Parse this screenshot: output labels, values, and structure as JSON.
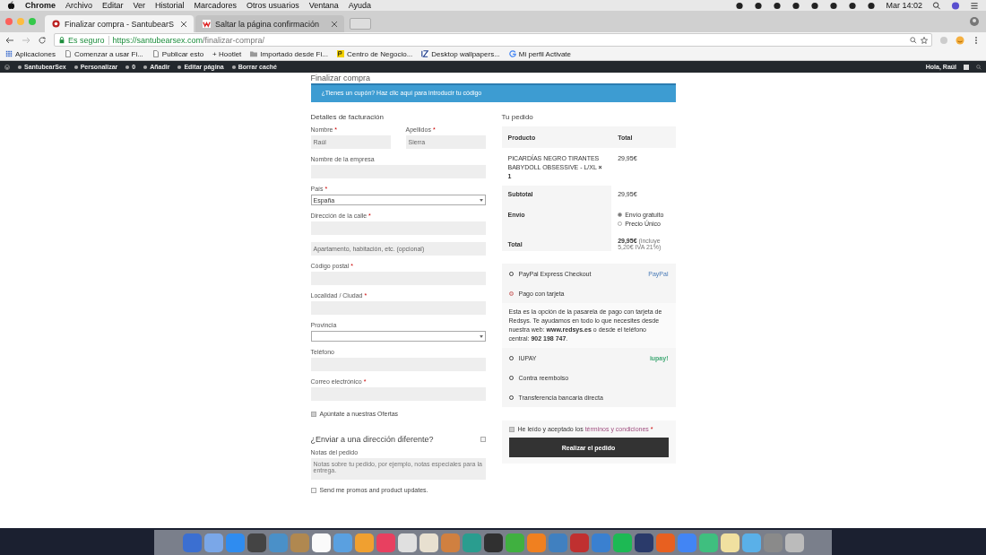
{
  "menu_bar": {
    "app": "Chrome",
    "items": [
      "Archivo",
      "Editar",
      "Ver",
      "Historial",
      "Marcadores",
      "Otros usuarios",
      "Ventana",
      "Ayuda"
    ],
    "clock": "Mar 14:02"
  },
  "tabs": [
    {
      "title": "Finalizar compra - SantubearS",
      "selected": true
    },
    {
      "title": "Saltar la página confirmación",
      "selected": false
    }
  ],
  "address_bar": {
    "secure_label": "Es seguro",
    "url_host": "https://santubearsex.com",
    "url_path": "/finalizar-compra/"
  },
  "bookmarks": [
    "Aplicaciones",
    "Comenzar a usar Fi...",
    "Publicar esto",
    "+ Hootlet",
    "Importado desde Fi...",
    "Centro de Negocio...",
    "Desktop wallpapers...",
    "Mi perfil Activate"
  ],
  "admin_bar": {
    "items": [
      "SantubearSex",
      "Personalizar",
      "0",
      "Añadir",
      "Editar página",
      "Borrar caché"
    ],
    "greeting": "Hola, Raúl"
  },
  "page": {
    "title": "Finalizar compra",
    "coupon_notice": "¿Tienes un cupón? Haz clic aquí para introducir tu código"
  },
  "billing": {
    "heading": "Detalles de facturación",
    "rows": [
      [
        {
          "kind": "text",
          "label": "Nombre",
          "required_mark": "*",
          "value": "Raúl"
        },
        {
          "kind": "text",
          "label": "Apellidos",
          "required_mark": "*",
          "value": "Sierra"
        }
      ],
      [
        {
          "kind": "text",
          "label": "Nombre de la empresa"
        }
      ],
      [
        {
          "kind": "select",
          "label": "País",
          "required_mark": "*",
          "value": "España"
        }
      ],
      [
        {
          "kind": "text",
          "label": "Dirección de la calle",
          "required_mark": "*"
        }
      ],
      [
        {
          "kind": "text",
          "placeholder": "Apartamento, habitación, etc. (opcional)"
        }
      ],
      [
        {
          "kind": "text",
          "label": "Código postal",
          "required_mark": "*"
        }
      ],
      [
        {
          "kind": "text",
          "label": "Localidad / Ciudad",
          "required_mark": "*"
        }
      ],
      [
        {
          "kind": "select",
          "label": "Provincia"
        }
      ],
      [
        {
          "kind": "text",
          "label": "Teléfono"
        }
      ],
      [
        {
          "kind": "text",
          "label": "Correo electrónico",
          "required_mark": "*"
        }
      ]
    ],
    "offers": {
      "label": "Apúntate a nuestras Ofertas",
      "checked": true
    }
  },
  "shipping": {
    "heading": "¿Enviar a una dirección diferente?",
    "checked": false,
    "notes_label": "Notas del pedido",
    "notes_placeholder": "Notas sobre tu pedido, por ejemplo, notas especiales para la entrega.",
    "promos": {
      "label": "Send me promos and product updates.",
      "checked": false
    }
  },
  "order": {
    "heading": "Tu pedido",
    "columns": [
      "Producto",
      "Total"
    ],
    "item": {
      "name": "PICARDÍAS NEGRO TIRANTES BABYDOLL OBSESSIVE - L/XL",
      "qty": "× 1",
      "price": "29,95€"
    },
    "subtotal_label": "Subtotal",
    "subtotal": "29,95€",
    "shipping_label": "Envío",
    "shipping_options": [
      {
        "label": "Envío gratuito",
        "selected": true
      },
      {
        "label": "Precio Único",
        "selected": false
      }
    ],
    "total_label": "Total",
    "total": "29,95€",
    "total_note": "(incluye 5,20€ IVA 21%)"
  },
  "payment": {
    "methods": [
      {
        "label": "PayPal Express Checkout",
        "selected": false,
        "logo": "PayPal"
      },
      {
        "label": "Pago con tarjeta",
        "selected": true,
        "description": "Esta es la opción de la pasarela de pago con tarjeta de Redsys. Te ayudamos en todo lo que necesites desde nuestra web: **www.redsys.es** o desde el teléfono central: **902 198 747**."
      },
      {
        "label": "IUPAY",
        "selected": false,
        "logo": "iupay!"
      },
      {
        "label": "Contra reembolso",
        "selected": false
      },
      {
        "label": "Transferencia bancaria directa",
        "selected": false
      }
    ]
  },
  "terms": {
    "text": "He leído y aceptado los",
    "link": "términos y condiciones",
    "required_mark": "*",
    "checked": true
  },
  "place_order": "Realizar el pedido"
}
